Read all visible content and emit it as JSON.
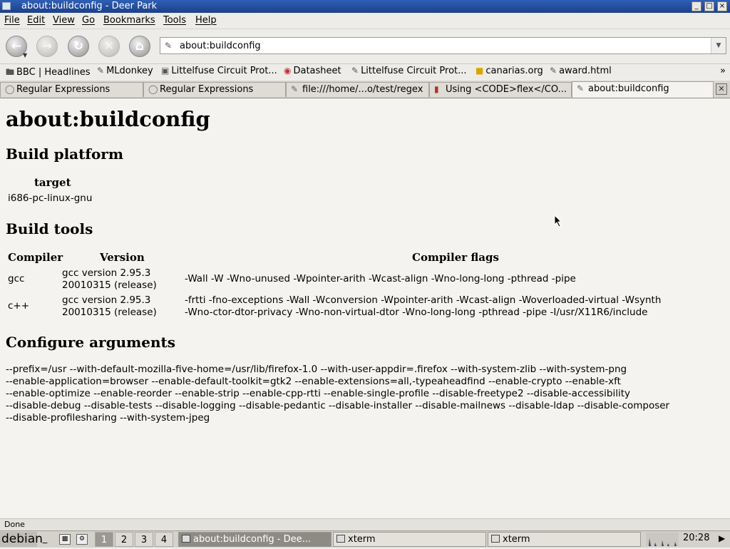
{
  "window": {
    "title": "about:buildconfig - Deer Park",
    "controls": {
      "minimize": "_",
      "maximize": "□",
      "close": "×"
    }
  },
  "menu": [
    {
      "label": "File"
    },
    {
      "label": "Edit"
    },
    {
      "label": "View"
    },
    {
      "label": "Go"
    },
    {
      "label": "Bookmarks"
    },
    {
      "label": "Tools"
    },
    {
      "label": "Help"
    }
  ],
  "nav": {
    "back_icon": "back-arrow-icon",
    "forward_icon": "forward-arrow-icon",
    "reload_icon": "reload-icon",
    "stop_icon": "stop-icon",
    "home_icon": "home-icon",
    "url": "about:buildconfig"
  },
  "bookmarks": {
    "items": [
      {
        "label": "BBC | Headlines",
        "icon": "folder-icon"
      },
      {
        "label": "MLdonkey",
        "icon": "bookmark-icon"
      },
      {
        "label": "Littelfuse Circuit Prot...",
        "icon": "site-icon"
      },
      {
        "label": "Datasheet",
        "icon": "site-icon"
      },
      {
        "label": "Littelfuse Circuit Prot...",
        "icon": "bookmark-icon"
      },
      {
        "label": "canarias.org",
        "icon": "site-icon"
      },
      {
        "label": "award.html",
        "icon": "bookmark-icon"
      }
    ],
    "more": "»"
  },
  "tabs": [
    {
      "label": "Regular Expressions"
    },
    {
      "label": "Regular Expressions"
    },
    {
      "label": "file:///home/...o/test/regex"
    },
    {
      "label": "Using <CODE>flex</CO..."
    },
    {
      "label": "about:buildconfig"
    }
  ],
  "page": {
    "title": "about:buildconfig",
    "platform": {
      "heading": "Build platform",
      "header": "target",
      "value": "i686-pc-linux-gnu"
    },
    "tools": {
      "heading": "Build tools",
      "headers": [
        "Compiler",
        "Version",
        "Compiler flags"
      ],
      "rows": [
        {
          "compiler": "gcc",
          "version_1": "gcc version 2.95.3",
          "version_2": "20010315 (release)",
          "flags_1": "-Wall -W -Wno-unused -Wpointer-arith -Wcast-align -Wno-long-long -pthread -pipe",
          "flags_2": ""
        },
        {
          "compiler": "c++",
          "version_1": "gcc version 2.95.3",
          "version_2": "20010315 (release)",
          "flags_1": "-frtti -fno-exceptions -Wall -Wconversion -Wpointer-arith -Wcast-align -Woverloaded-virtual -Wsynth",
          "flags_2": "-Wno-ctor-dtor-privacy -Wno-non-virtual-dtor -Wno-long-long -pthread -pipe -I/usr/X11R6/include"
        }
      ]
    },
    "configure": {
      "heading": "Configure arguments",
      "lines": [
        "--prefix=/usr --with-default-mozilla-five-home=/usr/lib/firefox-1.0 --with-user-appdir=.firefox --with-system-zlib --with-system-png",
        "--enable-application=browser --enable-default-toolkit=gtk2 --enable-extensions=all,-typeaheadfind --enable-crypto --enable-xft",
        "--enable-optimize --enable-reorder --enable-strip --enable-cpp-rtti --enable-single-profile --disable-freetype2 --disable-accessibility",
        "--disable-debug --disable-tests --disable-logging --disable-pedantic --disable-installer --disable-mailnews --disable-ldap --disable-composer",
        "--disable-profilesharing --with-system-jpeg"
      ]
    }
  },
  "status": "Done",
  "taskbar": {
    "start_label": "debian",
    "workspaces": [
      "1",
      "2",
      "3",
      "4"
    ],
    "tasks": [
      {
        "label": "about:buildconfig - Dee..."
      },
      {
        "label": "xterm"
      },
      {
        "label": "xterm"
      }
    ],
    "clock": "20:28"
  }
}
